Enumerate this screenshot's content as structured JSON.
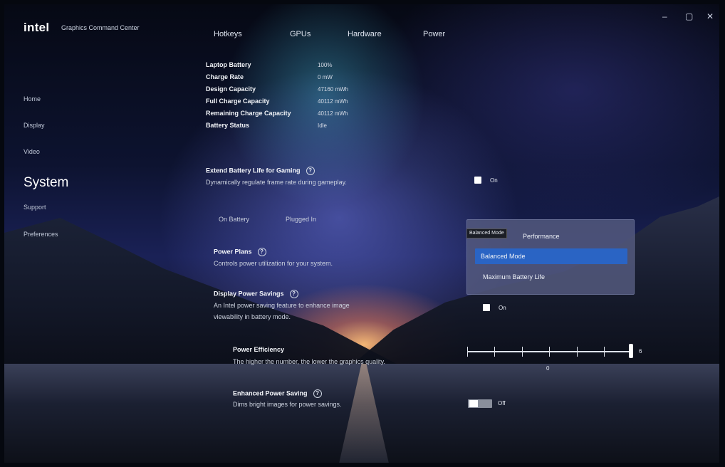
{
  "app": {
    "logo": "intel",
    "title": "Graphics Command Center",
    "window_controls": {
      "minimize": "–",
      "maximize": "▢",
      "close": "✕"
    }
  },
  "top_tabs": [
    "Hotkeys",
    "GPUs",
    "Hardware",
    "Power"
  ],
  "sidebar": {
    "items": [
      "Home",
      "Display",
      "Video"
    ],
    "active": "System",
    "items_after": [
      "Support",
      "Preferences"
    ]
  },
  "battery_info": [
    {
      "label": "Laptop Battery",
      "value": "100%"
    },
    {
      "label": "Charge Rate",
      "value": "0 mW"
    },
    {
      "label": "Design Capacity",
      "value": "47160 mWh"
    },
    {
      "label": "Full Charge Capacity",
      "value": "40112 mWh"
    },
    {
      "label": "Remaining Charge Capacity",
      "value": "40112 mWh"
    },
    {
      "label": "Battery Status",
      "value": "Idle"
    }
  ],
  "extend_battery": {
    "title": "Extend Battery Life for Gaming",
    "description": "Dynamically regulate frame rate during gameplay.",
    "checkbox_label": "On"
  },
  "power_tabs": [
    "On Battery",
    "Plugged In"
  ],
  "power_plans": {
    "title": "Power Plans",
    "description": "Controls power utilization for your system.",
    "tooltip": "Balanced Mode",
    "options": [
      "Performance",
      "Balanced Mode",
      "Maximum Battery Life"
    ],
    "selected": "Balanced Mode"
  },
  "display_power_savings": {
    "title": "Display Power Savings",
    "description_line1": "An Intel power saving feature to enhance image",
    "description_line2": "viewability in battery mode.",
    "checkbox_label": "On"
  },
  "power_efficiency": {
    "title": "Power Efficiency",
    "description": "The higher the number, the lower the graphics quality.",
    "min_label": "0",
    "max_label": "6",
    "value": 6
  },
  "enhanced_power_saving": {
    "title": "Enhanced Power Saving",
    "description": "Dims bright images for power savings.",
    "toggle_label": "Off"
  },
  "help_glyph": "?"
}
